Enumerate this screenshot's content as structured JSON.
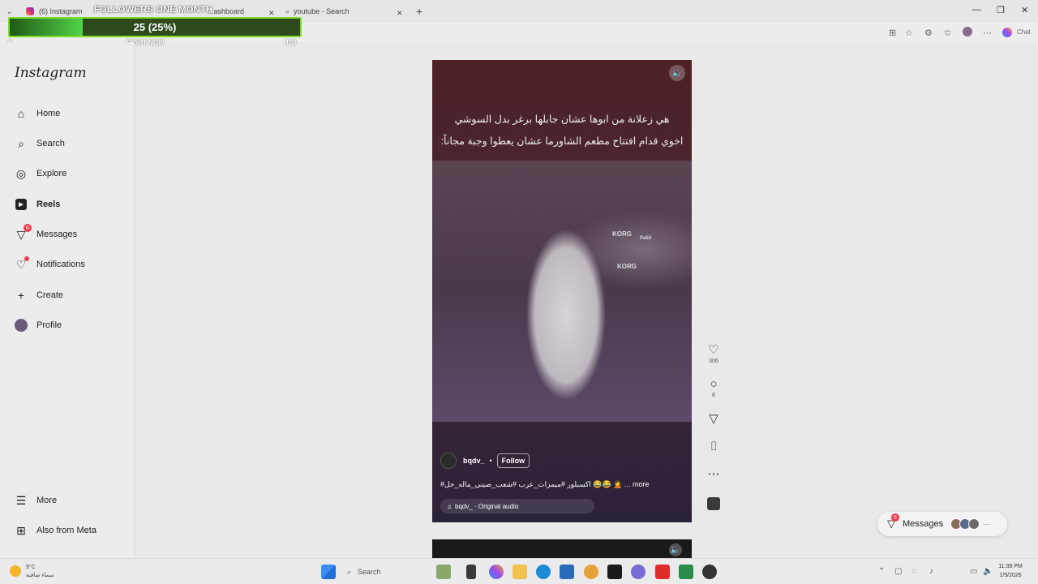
{
  "browser": {
    "tabs": [
      {
        "label": "(6) Instagram"
      },
      {
        "label": "...ashboard"
      },
      {
        "label": "youtube - Search"
      }
    ],
    "new_tab": "+",
    "chat_label": "Chat"
  },
  "followers_overlay": {
    "title": "FOLLOWERS ONE MONTH",
    "value": "25 (25%)",
    "progress_fraction": 0.25,
    "min_label": "0",
    "mid_label": "RIGHT NOW",
    "max_label": "100"
  },
  "sidebar": {
    "logo": "Instagram",
    "items": [
      {
        "label": "Home",
        "icon": "home-icon"
      },
      {
        "label": "Search",
        "icon": "search-icon"
      },
      {
        "label": "Explore",
        "icon": "compass-icon"
      },
      {
        "label": "Reels",
        "icon": "reels-icon"
      },
      {
        "label": "Messages",
        "icon": "messenger-icon",
        "badge": "6"
      },
      {
        "label": "Notifications",
        "icon": "heart-icon"
      },
      {
        "label": "Create",
        "icon": "plus-icon"
      },
      {
        "label": "Profile",
        "icon": "avatar"
      }
    ],
    "more": "More",
    "also_meta": "Also from Meta"
  },
  "reel": {
    "caption_line1": "هي زعلانة من ابوها  عشان جابلها برغر بدل السوشي",
    "caption_line2": "اخوي قدام افتتاح مطعم الشاورما عشان يعطوا وجبة مجاناً:",
    "brand_text": "KORG",
    "brand_model": "Pa5X",
    "username": "bqdv_",
    "separator": "•",
    "follow_label": "Follow",
    "description": "#اكسبلور #ميمزات_عرب #شعب_صيني_ماله_حل 😂😂 🤦 ... more",
    "audio": "bqdv_ · Original audio",
    "audio_icon": "♫"
  },
  "actions": {
    "likes": "306",
    "comments": "8"
  },
  "messages_pill": {
    "label": "Messages",
    "badge": "6",
    "more": "···"
  },
  "taskbar": {
    "weather_temp": "9°C",
    "weather_desc": "سماء صافية",
    "search_label": "Search",
    "time": "11:39 PM",
    "date": "1/9/2026"
  }
}
